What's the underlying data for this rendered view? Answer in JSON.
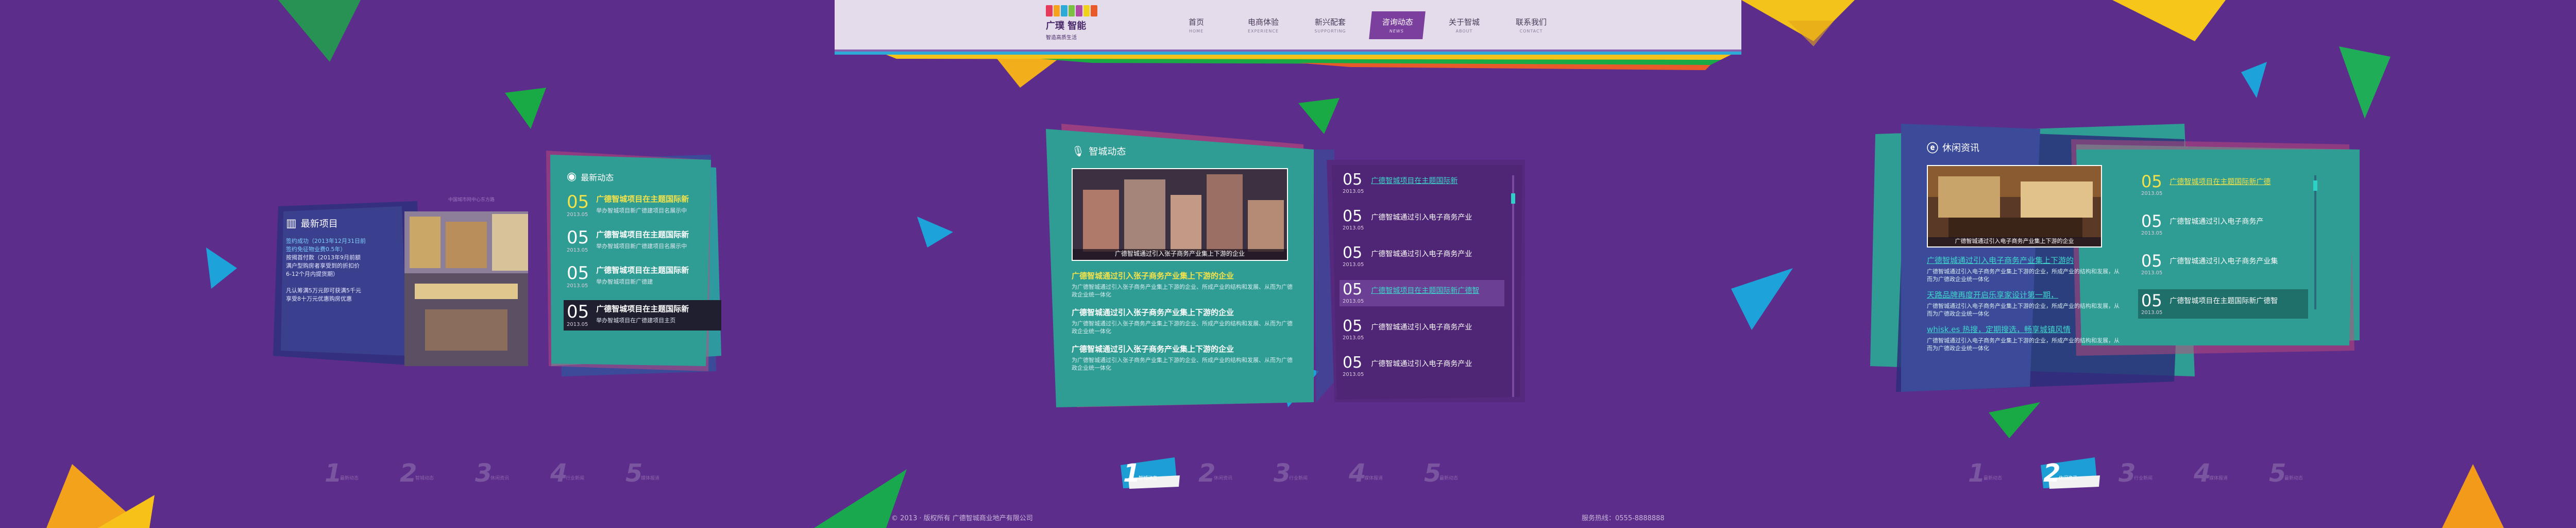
{
  "header": {
    "logo_name": "广璞 智能",
    "logo_slogan": "智造高质生活",
    "logo_colors": [
      "#e63a5a",
      "#f6a21a",
      "#2eaad6",
      "#7bc043",
      "#b04aa5",
      "#f0d21a",
      "#e85a2a"
    ]
  },
  "nav": [
    {
      "label": "首页",
      "en": "HOME",
      "active": false
    },
    {
      "label": "电商体验",
      "en": "EXPERIENCE",
      "active": false
    },
    {
      "label": "新兴配套",
      "en": "SUPPORTING",
      "active": false
    },
    {
      "label": "咨询动态",
      "en": "NEWS",
      "active": true
    },
    {
      "label": "关于智城",
      "en": "ABOUT",
      "active": false
    },
    {
      "label": "联系我们",
      "en": "CONTACT",
      "active": false
    }
  ],
  "left": {
    "dev_title": "最新项目",
    "dev_lines": [
      "签约成功（2013年12月31日前",
      "签约免征物业费0.5年）",
      "按揭首付款（2013年9月前额",
      "满户型购房者享受到的折扣价",
      "6-12个月内提货期）",
      "",
      "凡认筹满5万元即可获满5千元",
      "享受8十万元优惠购房优惠"
    ],
    "photo_caption": "中国城市网中心东方路",
    "news_title": "最新动态",
    "news": [
      {
        "day": "05",
        "ym": "2013.05",
        "title": "广德智城项目在主题国际新",
        "summary": "举办智城项目新广德建项目名展示中"
      },
      {
        "day": "05",
        "ym": "2013.05",
        "title": "广德智城项目在主题国际新",
        "summary": "举办智城项目新广德建项目名展示中"
      },
      {
        "day": "05",
        "ym": "2013.05",
        "title": "广德智城项目在主题国际新",
        "summary": "举办智城项目新广德建"
      },
      {
        "day": "05",
        "ym": "2013.05",
        "title": "广德智城项目在主题国际新",
        "summary": "举办智城项目在广德建项目主页"
      }
    ]
  },
  "center": {
    "title": "智城动态",
    "caption": "广德智城通过引入张子商务产业集上下游的企业",
    "articles": [
      {
        "title": "广德智城通过引入张子商务产业集上下游的企业",
        "text": "为广德智城通过引入张子商务产业集上下游的企业、所成产业的结构和发展、从而为广德政企业统一体化",
        "highlight": true
      },
      {
        "title": "广德智城通过引入张子商务产业集上下游的企业",
        "text": "为广德智城通过引入张子商务产业集上下游的企业、所成产业的结构和发展、从而为广德政企业统一体化",
        "highlight": false
      },
      {
        "title": "广德智城通过引入张子商务产业集上下游的企业",
        "text": "为广德智城通过引入张子商务产业集上下游的企业、所成产业的结构和发展、从而为广德政企业统一体化",
        "highlight": false
      }
    ],
    "list": [
      {
        "day": "05",
        "ym": "2013.05",
        "title": "广德智城项目在主题国际新",
        "highlight": true
      },
      {
        "day": "05",
        "ym": "2013.05",
        "title": "广德智城通过引入电子商务产业",
        "highlight": false
      },
      {
        "day": "05",
        "ym": "2013.05",
        "title": "广德智城通过引入电子商务产业",
        "highlight": false
      },
      {
        "day": "05",
        "ym": "2013.05",
        "title": "广德智城项目在主题国际新广德智",
        "highlight": true
      },
      {
        "day": "05",
        "ym": "2013.05",
        "title": "广德智城通过引入电子商务产业",
        "highlight": false
      },
      {
        "day": "05",
        "ym": "2013.05",
        "title": "广德智城通过引入电子商务产业",
        "highlight": false
      }
    ]
  },
  "right": {
    "title": "休闲资讯",
    "caption": "广德智城通过引入电子商务产业集上下游的企业",
    "articles": [
      {
        "title": "广德智城通过引入电子商务产业集上下游的",
        "text": "广德智城通过引入电子商务产业集上下游的企业，所成产业的结构和发展，从而为广德政企业统一体化"
      },
      {
        "title": "天路品牌再度开启乐享家设计第一期，",
        "text": "广德智城通过引入电子商务产业集上下游的企业，所成产业的结构和发展，从而为广德政企业统一体化"
      },
      {
        "title": "whisk.es 热搜，定期搜选，畅享城镇风情",
        "text": "广德智城通过引入电子商务产业集上下游的企业，所成产业的结构和发展，从而为广德政企业统一体化"
      }
    ],
    "list": [
      {
        "day": "05",
        "ym": "2013.05",
        "title": "广德智城项目在主题国际新广德",
        "highlight": true
      },
      {
        "day": "05",
        "ym": "2013.05",
        "title": "广德智城通过引入电子商务产",
        "highlight": false
      },
      {
        "day": "05",
        "ym": "2013.05",
        "title": "广德智城通过引入电子商务产业集",
        "highlight": false
      },
      {
        "day": "05",
        "ym": "2013.05",
        "title": "广德智城项目在主题国际新广德智",
        "highlight": false
      }
    ]
  },
  "pagers": [
    {
      "items": [
        {
          "num": "1",
          "label": "最新动态"
        },
        {
          "num": "2",
          "label": "智城动态"
        },
        {
          "num": "3",
          "label": "休闲资讯"
        },
        {
          "num": "4",
          "label": "行业新闻"
        },
        {
          "num": "5",
          "label": "媒体报道"
        }
      ],
      "active": null
    },
    {
      "items": [
        {
          "num": "1",
          "label": "智城动态"
        },
        {
          "num": "2",
          "label": "休闲资讯"
        },
        {
          "num": "3",
          "label": "行业新闻"
        },
        {
          "num": "4",
          "label": "媒体报道"
        },
        {
          "num": "5",
          "label": "最新动态"
        }
      ],
      "active": 0
    },
    {
      "items": [
        {
          "num": "1",
          "label": "最新动态"
        },
        {
          "num": "2",
          "label": "休闲资讯"
        },
        {
          "num": "3",
          "label": "行业新闻"
        },
        {
          "num": "4",
          "label": "媒体报道"
        },
        {
          "num": "5",
          "label": "最新动态"
        }
      ],
      "active": 1
    }
  ],
  "footer": {
    "copyright": "© 2013 · 版权所有 广德智城商业地产有限公司",
    "hotline": "服务热线：0555-8888888"
  }
}
